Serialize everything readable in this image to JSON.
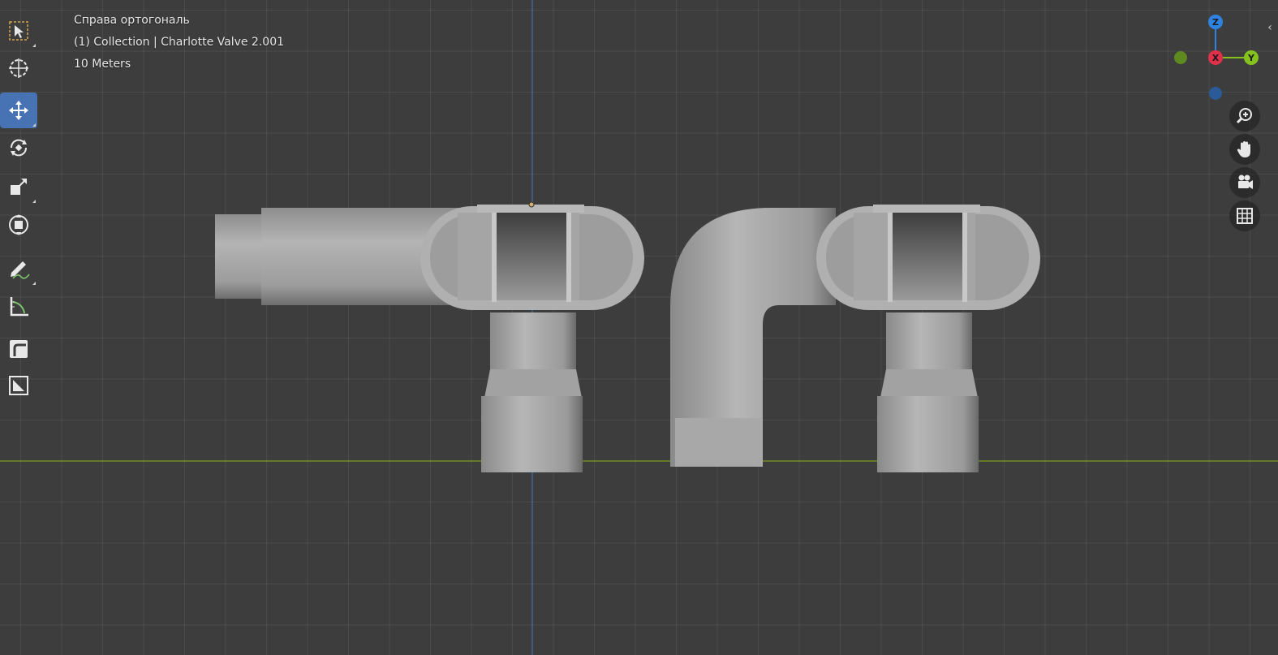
{
  "viewport": {
    "view_name": "Справа ортогональ",
    "collection_line": "(1) Collection | Charlotte Valve 2.001",
    "scale_label": "10 Meters"
  },
  "gizmo": {
    "z_label": "Z",
    "x_label": "X",
    "y_label": "Y",
    "colors": {
      "z": "#2f83e0",
      "x": "#e0304a",
      "y": "#86c21d"
    }
  },
  "toolbar": {
    "tools": [
      {
        "name": "select-box-tool",
        "icon": "cursor-select-icon",
        "active": false
      },
      {
        "name": "cursor-tool",
        "icon": "3d-cursor-icon",
        "active": false
      },
      {
        "name": "move-tool",
        "icon": "move-arrows-icon",
        "active": true
      },
      {
        "name": "rotate-tool",
        "icon": "rotate-icon",
        "active": false
      },
      {
        "name": "scale-tool",
        "icon": "scale-icon",
        "active": false
      },
      {
        "name": "transform-tool",
        "icon": "transform-icon",
        "active": false
      },
      {
        "name": "annotate-tool",
        "icon": "annotate-pencil-icon",
        "active": false
      },
      {
        "name": "measure-tool",
        "icon": "ruler-icon",
        "active": false
      },
      {
        "name": "add-cube-tool",
        "icon": "extrude-icon",
        "active": false
      },
      {
        "name": "add-plane-tool",
        "icon": "bevel-icon",
        "active": false
      }
    ]
  },
  "navigation": {
    "buttons": [
      "zoom-icon",
      "pan-hand-icon",
      "camera-icon",
      "grid-ortho-icon"
    ]
  },
  "colors": {
    "accent": "#4772b3",
    "background": "#3d3d3d",
    "model": "#a9a9a9"
  }
}
